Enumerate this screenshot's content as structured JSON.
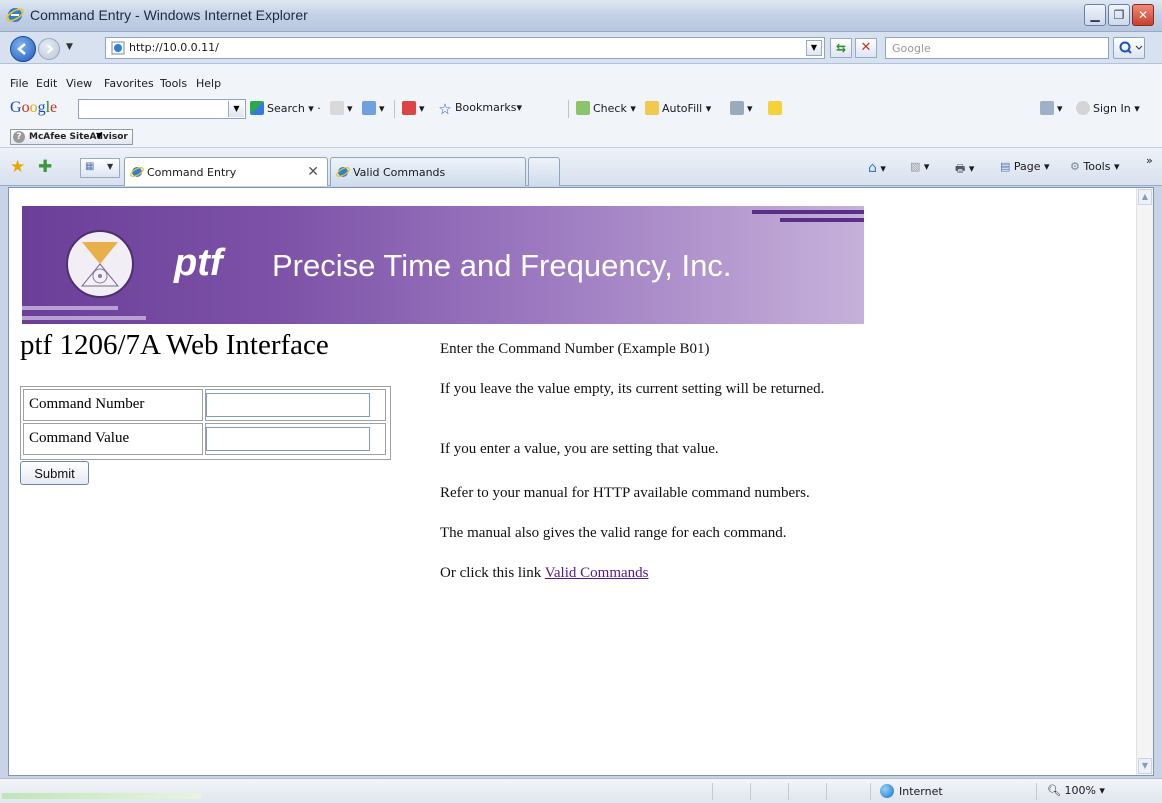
{
  "window": {
    "title": "Command Entry - Windows Internet Explorer",
    "minimize": "▁",
    "restore": "❐",
    "close": "✕"
  },
  "address": {
    "url": "http://10.0.0.11/",
    "search_placeholder": "Google"
  },
  "menu": [
    "File",
    "Edit",
    "View",
    "Favorites",
    "Tools",
    "Help"
  ],
  "google_toolbar": {
    "search": "Search",
    "bookmarks": "Bookmarks",
    "check": "Check",
    "autofill": "AutoFill",
    "sign_in": "Sign In"
  },
  "mcafee": {
    "label": "McAfee SiteAdvisor"
  },
  "tabs": {
    "active": "Command Entry",
    "inactive": "Valid Commands"
  },
  "command_bar": {
    "page": "Page",
    "tools": "Tools"
  },
  "banner": {
    "logo_text": "ptf",
    "company": "Precise Time and Frequency, Inc."
  },
  "page": {
    "heading": "ptf 1206/7A Web Interface",
    "command_number_label": "Command Number",
    "command_value_label": "Command Value",
    "command_number_value": "",
    "command_value_value": "",
    "submit_label": "Submit",
    "info_1": "Enter the Command Number (Example B01)",
    "info_2": "If you leave the value empty, its current setting will be returned.",
    "info_3": "If you enter a value, you are setting that value.",
    "info_4": "Refer to your manual for HTTP available command numbers.",
    "info_5": "The manual also gives the valid range for each command.",
    "info_6_prefix": "Or click this link",
    "info_6_link": "Valid Commands"
  },
  "status": {
    "zone": "Internet",
    "zoom": "100%"
  }
}
